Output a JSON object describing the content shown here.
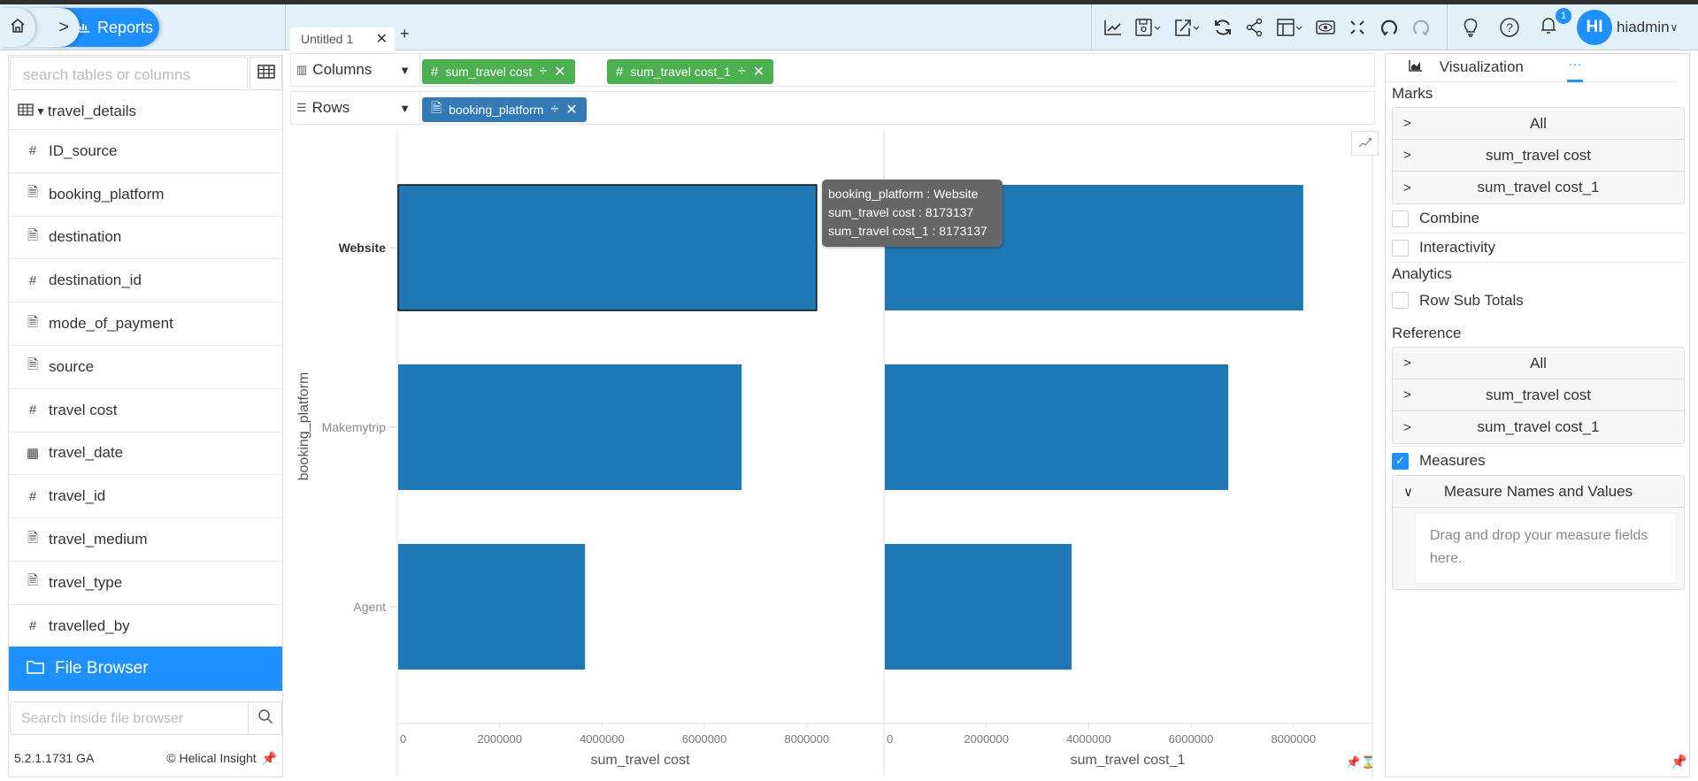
{
  "header": {
    "breadcrumb_home_icon": "home-icon",
    "breadcrumb_separator": ">",
    "breadcrumb_current": "Reports",
    "tabs": [
      {
        "label": "Untitled 1",
        "close": "✕"
      }
    ],
    "add_tab": "+",
    "toolbar_icons": [
      "chart-icon",
      "save-icon",
      "export-icon",
      "refresh-icon",
      "share-icon",
      "layout-icon",
      "preview-icon",
      "fullscreen-icon",
      "undo-icon",
      "redo-icon"
    ],
    "notifications_count": "1",
    "user_initials": "HI",
    "user_name": "hiadmin"
  },
  "left_panel": {
    "search_placeholder": "search tables or columns",
    "table_name": "travel_details",
    "fields": [
      {
        "type": "#",
        "name": "ID_source"
      },
      {
        "type": "text",
        "name": "booking_platform"
      },
      {
        "type": "text",
        "name": "destination"
      },
      {
        "type": "#",
        "name": "destination_id"
      },
      {
        "type": "text",
        "name": "mode_of_payment"
      },
      {
        "type": "text",
        "name": "source"
      },
      {
        "type": "#",
        "name": "travel cost"
      },
      {
        "type": "date",
        "name": "travel_date"
      },
      {
        "type": "#",
        "name": "travel_id"
      },
      {
        "type": "text",
        "name": "travel_medium"
      },
      {
        "type": "text",
        "name": "travel_type"
      },
      {
        "type": "#",
        "name": "travelled_by"
      }
    ],
    "file_browser_label": "File Browser",
    "file_search_placeholder": "Search inside file browser",
    "version": "5.2.1.1731 GA",
    "brand": "Helical Insight"
  },
  "shelves": {
    "columns_label": "Columns",
    "rows_label": "Rows",
    "column_pills": [
      {
        "label": "sum_travel cost",
        "type": "#"
      },
      {
        "label": "sum_travel cost_1",
        "type": "#"
      }
    ],
    "row_pills": [
      {
        "label": "booking_platform",
        "type": "text"
      }
    ]
  },
  "chart_data": {
    "type": "bar",
    "orientation": "horizontal",
    "categories": [
      "Website",
      "Makemytrip",
      "Agent"
    ],
    "ylabel": "booking_platform",
    "series": [
      {
        "name": "sum_travel cost",
        "values": [
          8173137,
          6710000,
          3650000
        ],
        "xlabel": "sum_travel cost"
      },
      {
        "name": "sum_travel cost_1",
        "values": [
          8173137,
          6710000,
          3650000
        ],
        "xlabel": "sum_travel cost_1"
      }
    ],
    "xticks": [
      0,
      2000000,
      4000000,
      6000000,
      8000000
    ],
    "xlim": [
      0,
      9800000
    ],
    "bar_color": "#1f77b4",
    "highlighted_category": "Website",
    "grid": false
  },
  "tooltip": {
    "lines": [
      "booking_platform : Website",
      "sum_travel cost : 8173137",
      "sum_travel cost_1 : 8173137"
    ]
  },
  "right_panel": {
    "tab_label": "Visualization",
    "tab_more": "···",
    "marks_title": "Marks",
    "marks_items": [
      "All",
      "sum_travel cost",
      "sum_travel cost_1"
    ],
    "combine_label": "Combine",
    "combine_checked": false,
    "interactivity_label": "Interactivity",
    "interactivity_checked": false,
    "analytics_title": "Analytics",
    "row_sub_totals_label": "Row Sub Totals",
    "row_sub_totals_checked": false,
    "reference_title": "Reference",
    "reference_items": [
      "All",
      "sum_travel cost",
      "sum_travel cost_1"
    ],
    "measures_label": "Measures",
    "measures_checked": true,
    "measure_names_label": "Measure Names and Values",
    "dropzone_text": "Drag and drop your measure fields here."
  }
}
